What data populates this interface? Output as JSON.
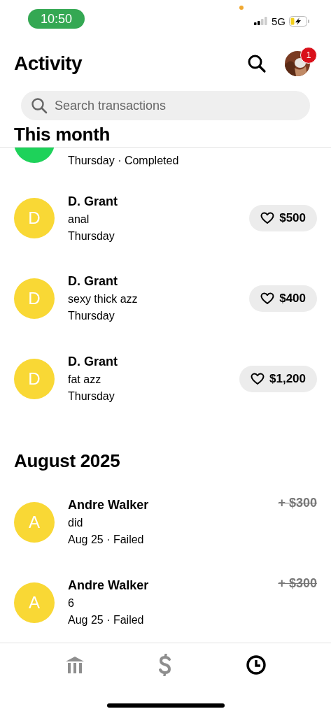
{
  "status_bar": {
    "time": "10:50",
    "network": "5G"
  },
  "header": {
    "title": "Activity",
    "badge": "1"
  },
  "search": {
    "placeholder": "Search transactions"
  },
  "sections": [
    {
      "title": "This month",
      "items": [
        {
          "partial": true,
          "color": "#1ed25a",
          "date": "Thursday · Completed",
          "kind": "none"
        },
        {
          "partial": false,
          "avatar": "D",
          "color": "#f9d835",
          "name": "D. Grant",
          "memo": "anal",
          "date": "Thursday",
          "amount": "$500",
          "kind": "pill"
        },
        {
          "partial": false,
          "avatar": "D",
          "color": "#f9d835",
          "name": "D. Grant",
          "memo": "sexy thick azz",
          "date": "Thursday",
          "amount": "$400",
          "kind": "pill"
        },
        {
          "partial": false,
          "avatar": "D",
          "color": "#f9d835",
          "name": "D. Grant",
          "memo": "fat azz",
          "date": "Thursday",
          "amount": "$1,200",
          "kind": "pill"
        }
      ]
    },
    {
      "title": "August 2025",
      "items": [
        {
          "partial": false,
          "avatar": "A",
          "color": "#f9d835",
          "name": "Andre Walker",
          "memo": "did",
          "date": "Aug 25 · Failed",
          "amount": "+ $300",
          "kind": "struck"
        },
        {
          "partial": false,
          "avatar": "A",
          "color": "#f9d835",
          "name": "Andre Walker",
          "memo": "6",
          "date": "Aug 25 · Failed",
          "amount": "+ $300",
          "kind": "struck"
        }
      ]
    }
  ],
  "nav": [
    {
      "kind": "bank",
      "selected": false
    },
    {
      "kind": "dollar",
      "selected": false
    },
    {
      "kind": "clock",
      "selected": true
    }
  ]
}
